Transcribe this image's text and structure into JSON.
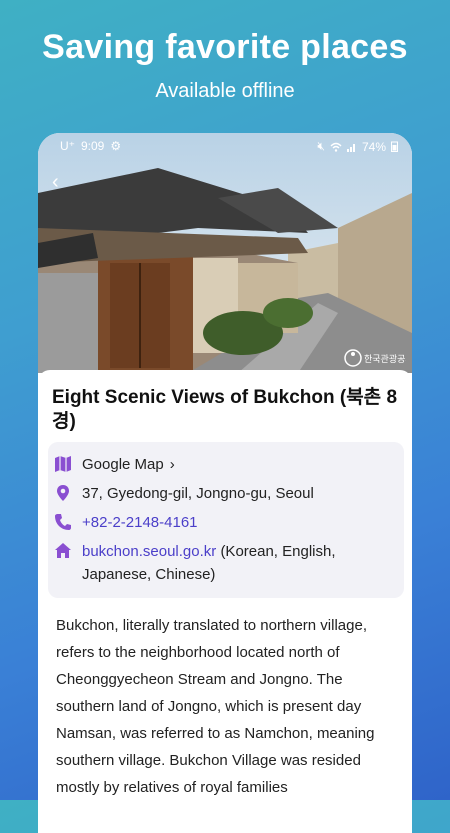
{
  "promo": {
    "title": "Saving favorite places",
    "subtitle": "Available offline"
  },
  "status_bar": {
    "carrier": "U⁺",
    "time": "9:09",
    "battery": "74%"
  },
  "place": {
    "title": "Eight Scenic Views of Bukchon (북촌 8경)",
    "map_label": "Google Map",
    "address": "37, Gyedong-gil, Jongno-gu, Seoul",
    "phone": "+82-2-2148-4161",
    "website": "bukchon.seoul.go.kr",
    "website_note": "(Korean, English, Japanese, Chinese)",
    "description": "Bukchon, literally translated to northern village, refers to the neighborhood located north of Cheonggyecheon Stream and Jongno. The southern land of Jongno, which is present day Namsan, was referred to as Namchon, meaning southern village. Bukchon Village was resided mostly by relatives of royal families",
    "watermark": "한국관광공사"
  },
  "colors": {
    "accent_purple": "#8a4fd1",
    "link": "#4b3fc9",
    "bg_gradient_start": "#3fb0c4",
    "bg_gradient_end": "#2f64c9"
  },
  "icons": [
    "map-icon",
    "location-pin-icon",
    "phone-icon",
    "home-icon",
    "chevron-right-icon",
    "back-arrow-icon",
    "settings-gear-icon",
    "mute-icon",
    "wifi-icon",
    "signal-icon",
    "battery-icon"
  ]
}
